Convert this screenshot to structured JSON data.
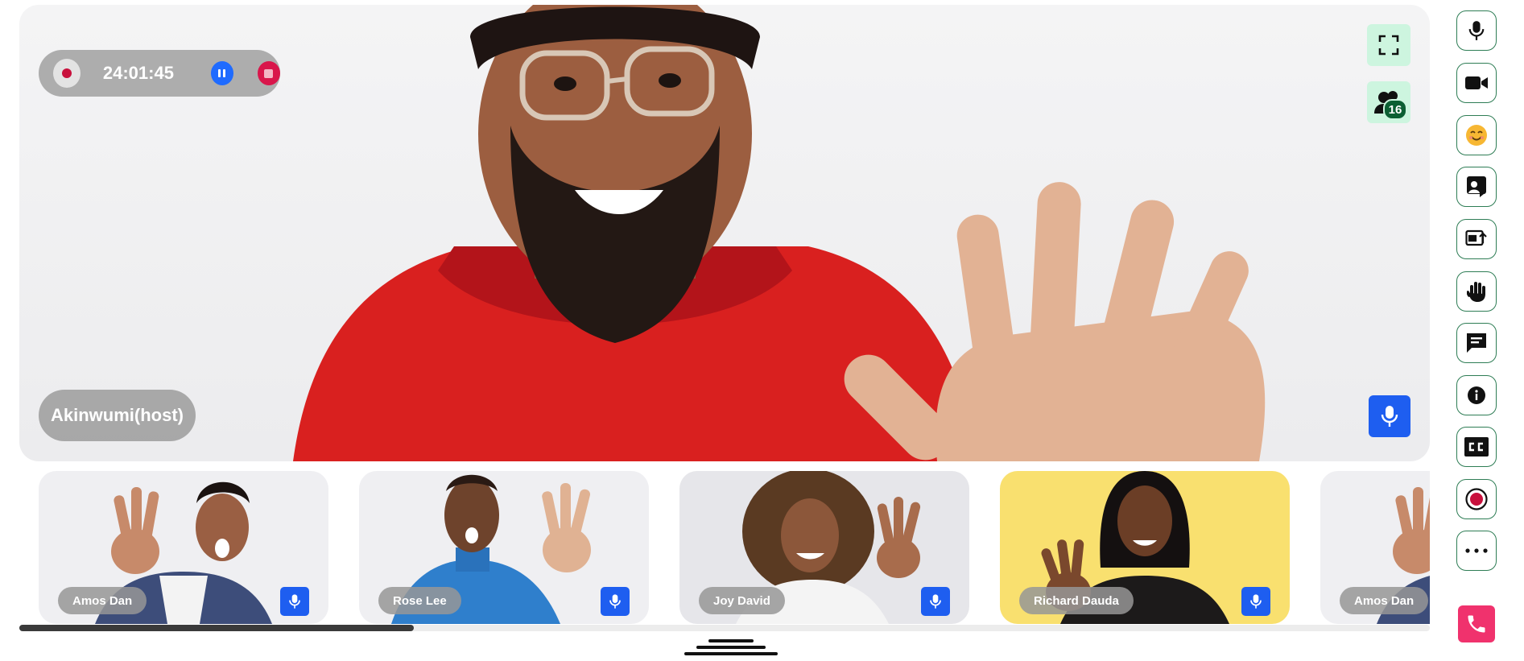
{
  "recording": {
    "time": "24:01:45"
  },
  "main": {
    "host_label": "Akinwumi(host)",
    "participant_count": "16"
  },
  "thumbnails": [
    {
      "name": "Amos Dan"
    },
    {
      "name": "Rose Lee"
    },
    {
      "name": "Joy David"
    },
    {
      "name": "Richard Dauda"
    },
    {
      "name": "Amos Dan"
    }
  ],
  "toolbar": {
    "items": [
      {
        "icon": "microphone-icon"
      },
      {
        "icon": "video-camera-icon"
      },
      {
        "icon": "emoji-icon"
      },
      {
        "icon": "person-chat-icon"
      },
      {
        "icon": "share-screen-icon"
      },
      {
        "icon": "raise-hand-icon"
      },
      {
        "icon": "chat-icon"
      },
      {
        "icon": "info-icon"
      },
      {
        "icon": "closed-captions-icon"
      },
      {
        "icon": "record-icon"
      },
      {
        "icon": "more-icon"
      }
    ],
    "end_call_icon": "phone-icon"
  },
  "colors": {
    "accent_blue": "#1e5ef0",
    "record_red": "#c8103c",
    "end_call_pink": "#f0326d",
    "tool_border_green": "#2e7d55",
    "corner_button_mint": "#cdf5df",
    "badge_green": "#0c5f33",
    "yellow_tile": "#f9e06f"
  }
}
